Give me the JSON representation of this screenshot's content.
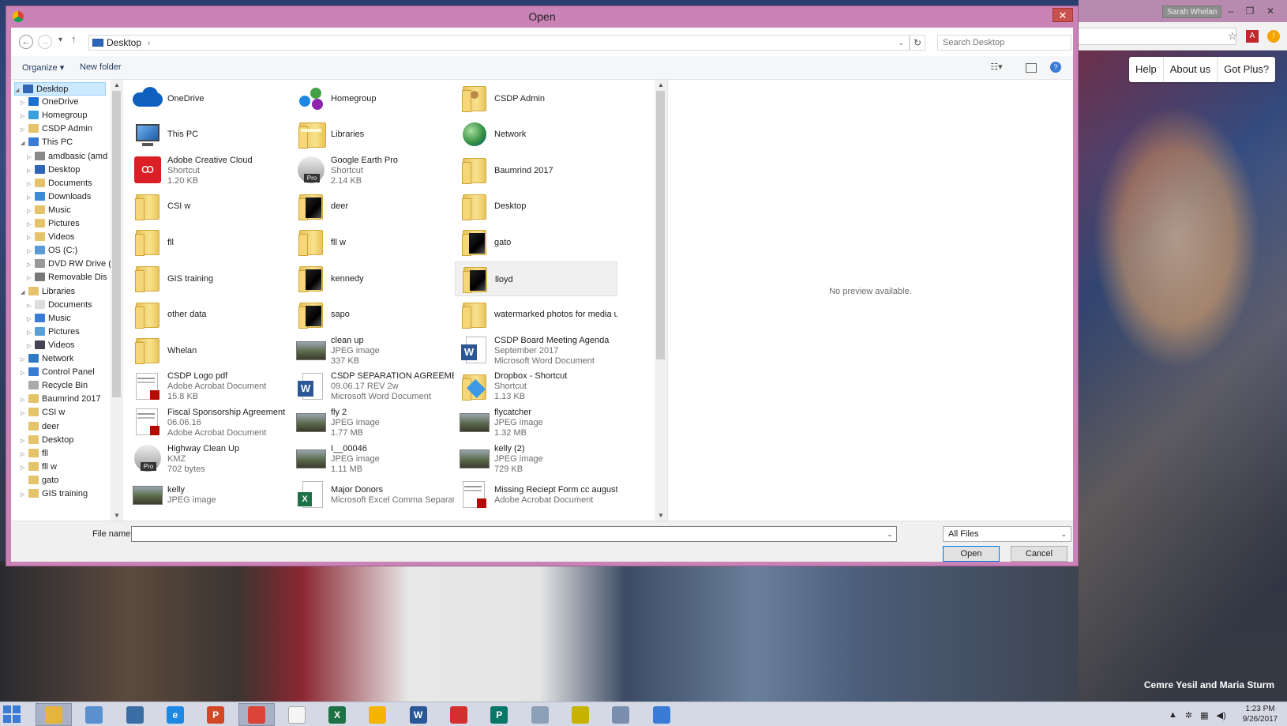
{
  "dialog": {
    "title": "Open",
    "close_label": "✕",
    "breadcrumb": "Desktop",
    "search_placeholder": "Search Desktop",
    "organize_label": "Organize ▾",
    "new_folder_label": "New folder",
    "preview_text": "No preview available.",
    "file_name_label": "File name:",
    "file_name_value": "",
    "filter_value": "All Files",
    "open_label": "Open",
    "cancel_label": "Cancel"
  },
  "nav_tree": [
    {
      "label": "Desktop",
      "indent": 0,
      "arrow": "◢",
      "icon": "#2f66b8",
      "selected": true
    },
    {
      "label": "OneDrive",
      "indent": 1,
      "arrow": "▷",
      "icon": "#1b6fd1"
    },
    {
      "label": "Homegroup",
      "indent": 1,
      "arrow": "▷",
      "icon": "#3aa0dc"
    },
    {
      "label": "CSDP Admin",
      "indent": 1,
      "arrow": "▷",
      "icon": "#e4c36a"
    },
    {
      "label": "This PC",
      "indent": 1,
      "arrow": "◢",
      "icon": "#3a7bd5"
    },
    {
      "label": "amdbasic (amd",
      "indent": 2,
      "arrow": "▷",
      "icon": "#888"
    },
    {
      "label": "Desktop",
      "indent": 2,
      "arrow": "▷",
      "icon": "#2f66b8"
    },
    {
      "label": "Documents",
      "indent": 2,
      "arrow": "▷",
      "icon": "#e4c36a"
    },
    {
      "label": "Downloads",
      "indent": 2,
      "arrow": "▷",
      "icon": "#3a8ad5"
    },
    {
      "label": "Music",
      "indent": 2,
      "arrow": "▷",
      "icon": "#e4c36a"
    },
    {
      "label": "Pictures",
      "indent": 2,
      "arrow": "▷",
      "icon": "#e4c36a"
    },
    {
      "label": "Videos",
      "indent": 2,
      "arrow": "▷",
      "icon": "#e4c36a"
    },
    {
      "label": "OS (C:)",
      "indent": 2,
      "arrow": "▷",
      "icon": "#5a9ad8"
    },
    {
      "label": "DVD RW Drive (",
      "indent": 2,
      "arrow": "▷",
      "icon": "#999"
    },
    {
      "label": "Removable Dis",
      "indent": 2,
      "arrow": "▷",
      "icon": "#777"
    },
    {
      "label": "Libraries",
      "indent": 1,
      "arrow": "◢",
      "icon": "#e4c36a"
    },
    {
      "label": "Documents",
      "indent": 2,
      "arrow": "▷",
      "icon": "#ddd"
    },
    {
      "label": "Music",
      "indent": 2,
      "arrow": "▷",
      "icon": "#3a7bd5"
    },
    {
      "label": "Pictures",
      "indent": 2,
      "arrow": "▷",
      "icon": "#5aa0d8"
    },
    {
      "label": "Videos",
      "indent": 2,
      "arrow": "▷",
      "icon": "#445"
    },
    {
      "label": "Network",
      "indent": 1,
      "arrow": "▷",
      "icon": "#2e7bc4"
    },
    {
      "label": "Control Panel",
      "indent": 1,
      "arrow": "▷",
      "icon": "#3a7bd5"
    },
    {
      "label": "Recycle Bin",
      "indent": 1,
      "arrow": "",
      "icon": "#aaa"
    },
    {
      "label": "Baumrind 2017",
      "indent": 1,
      "arrow": "▷",
      "icon": "#e4c36a"
    },
    {
      "label": "CSI w",
      "indent": 1,
      "arrow": "▷",
      "icon": "#e4c36a"
    },
    {
      "label": "deer",
      "indent": 1,
      "arrow": "",
      "icon": "#e4c36a"
    },
    {
      "label": "Desktop",
      "indent": 1,
      "arrow": "▷",
      "icon": "#e4c36a"
    },
    {
      "label": "fll",
      "indent": 1,
      "arrow": "▷",
      "icon": "#e4c36a"
    },
    {
      "label": "fll w",
      "indent": 1,
      "arrow": "▷",
      "icon": "#e4c36a"
    },
    {
      "label": "gato",
      "indent": 1,
      "arrow": "",
      "icon": "#e4c36a"
    },
    {
      "label": "GIS training",
      "indent": 1,
      "arrow": "▷",
      "icon": "#e4c36a"
    }
  ],
  "files": [
    [
      {
        "name": "OneDrive",
        "icon": "cloud"
      },
      {
        "name": "This PC",
        "icon": "pc"
      },
      {
        "name": "Adobe Creative Cloud",
        "sub1": "Shortcut",
        "sub2": "1.20 KB",
        "icon": "adobe"
      },
      {
        "name": "CSI w",
        "icon": "folder"
      },
      {
        "name": "fll",
        "icon": "folder"
      },
      {
        "name": "GIS training",
        "icon": "folder"
      },
      {
        "name": "other data",
        "icon": "folder"
      },
      {
        "name": "Whelan",
        "icon": "folder"
      },
      {
        "name": "CSDP Logo pdf",
        "sub1": "Adobe Acrobat Document",
        "sub2": "15.8 KB",
        "icon": "pdf"
      },
      {
        "name": "Fiscal Sponsorship Agreement",
        "sub1": "06.06.16",
        "sub2": "Adobe Acrobat Document",
        "icon": "pdf"
      },
      {
        "name": "Highway Clean Up",
        "sub1": "KMZ",
        "sub2": "702 bytes",
        "icon": "earth"
      },
      {
        "name": "kelly",
        "sub1": "JPEG image",
        "icon": "photo"
      }
    ],
    [
      {
        "name": "Homegroup",
        "icon": "homegroup"
      },
      {
        "name": "Libraries",
        "icon": "libraries"
      },
      {
        "name": "Google Earth Pro",
        "sub1": "Shortcut",
        "sub2": "2.14 KB",
        "icon": "earth"
      },
      {
        "name": "deer",
        "icon": "folder-dark"
      },
      {
        "name": "fll w",
        "icon": "folder"
      },
      {
        "name": "kennedy",
        "icon": "folder-dark"
      },
      {
        "name": "sapo",
        "icon": "folder-dark"
      },
      {
        "name": "clean up",
        "sub1": "JPEG image",
        "sub2": "337 KB",
        "icon": "photo"
      },
      {
        "name": "CSDP SEPARATION AGREEMENT",
        "sub1": "09.06.17 REV 2w",
        "sub2": "Microsoft Word Document",
        "icon": "word"
      },
      {
        "name": "fly 2",
        "sub1": "JPEG image",
        "sub2": "1.77 MB",
        "icon": "photo"
      },
      {
        "name": "I__00046",
        "sub1": "JPEG image",
        "sub2": "1.11 MB",
        "icon": "photo"
      },
      {
        "name": "Major Donors",
        "sub1": "Microsoft Excel Comma Separate...",
        "icon": "excel"
      }
    ],
    [
      {
        "name": "CSDP Admin",
        "icon": "folder-user"
      },
      {
        "name": "Network",
        "icon": "network"
      },
      {
        "name": "Baumrind 2017",
        "icon": "folder"
      },
      {
        "name": "Desktop",
        "icon": "folder"
      },
      {
        "name": "gato",
        "icon": "folder-dark"
      },
      {
        "name": "lloyd",
        "icon": "folder-dark",
        "state": "selected"
      },
      {
        "name": "watermarked photos for media use",
        "icon": "folder"
      },
      {
        "name": "CSDP Board Meeting Agenda",
        "sub1": "September 2017",
        "sub2": "Microsoft Word Document",
        "icon": "word"
      },
      {
        "name": "Dropbox - Shortcut",
        "sub1": "Shortcut",
        "sub2": "1.13 KB",
        "icon": "dropbox"
      },
      {
        "name": "flycatcher",
        "sub1": "JPEG image",
        "sub2": "1.32 MB",
        "icon": "photo"
      },
      {
        "name": "kelly (2)",
        "sub1": "JPEG image",
        "sub2": "729 KB",
        "icon": "photo"
      },
      {
        "name": "Missing Reciept Form cc august",
        "sub1": "Adobe Acrobat Document",
        "icon": "pdf"
      }
    ]
  ],
  "browser": {
    "user_badge": "Sarah Whelan",
    "nav_links": [
      "Help",
      "About us",
      "Got Plus?"
    ],
    "photo_caption": "Cemre Yesil and Maria Sturm"
  },
  "taskbar": {
    "apps": [
      {
        "name": "file-explorer",
        "color": "#e4b43c",
        "glyph": "",
        "active": true
      },
      {
        "name": "app-2",
        "color": "#5a8fd0",
        "glyph": ""
      },
      {
        "name": "app-3",
        "color": "#3a6ea5",
        "glyph": ""
      },
      {
        "name": "internet-explorer",
        "color": "#1e88e5",
        "glyph": "e"
      },
      {
        "name": "powerpoint",
        "color": "#d24726",
        "glyph": "P"
      },
      {
        "name": "chrome",
        "color": "#db4437",
        "glyph": "",
        "active": true
      },
      {
        "name": "blank-file",
        "color": "#f5f5f5",
        "glyph": ""
      },
      {
        "name": "excel",
        "color": "#1e7145",
        "glyph": "X"
      },
      {
        "name": "chrome-2",
        "color": "#f4b400",
        "glyph": ""
      },
      {
        "name": "word",
        "color": "#2b5797",
        "glyph": "W"
      },
      {
        "name": "app-11",
        "color": "#d32f2f",
        "glyph": ""
      },
      {
        "name": "publisher",
        "color": "#077568",
        "glyph": "P"
      },
      {
        "name": "calculator",
        "color": "#8ca0b8",
        "glyph": ""
      },
      {
        "name": "app-14",
        "color": "#c7b200",
        "glyph": ""
      },
      {
        "name": "app-15",
        "color": "#7a8fb0",
        "glyph": ""
      },
      {
        "name": "search-app",
        "color": "#3a7bd5",
        "glyph": ""
      }
    ],
    "time": "1:23 PM",
    "date": "9/26/2017"
  }
}
